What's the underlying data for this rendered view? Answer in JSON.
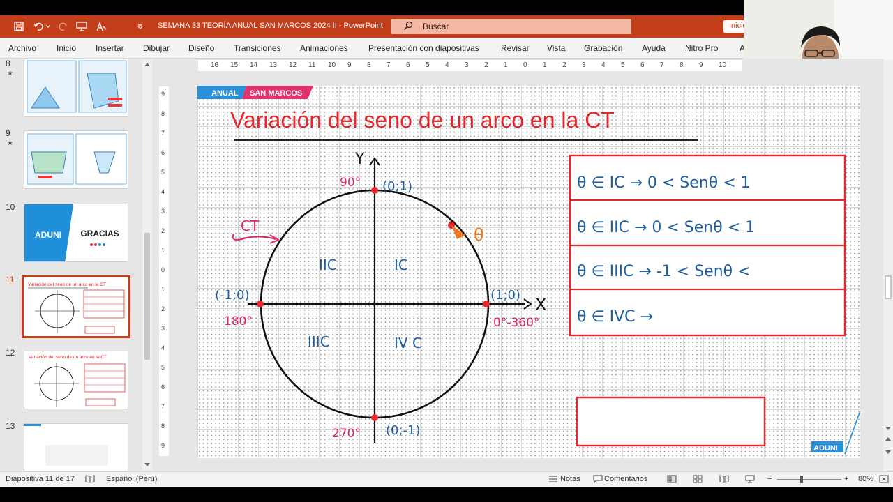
{
  "window": {
    "title": "SEMANA 33 TEORÍA ANUAL SAN MARCOS 2024 II  -  PowerPoint",
    "search_placeholder": "Buscar",
    "start_button": "Inicio",
    "accent": "#c43e1c"
  },
  "ribbon": {
    "tabs": [
      "Archivo",
      "Inicio",
      "Insertar",
      "Dibujar",
      "Diseño",
      "Transiciones",
      "Animaciones",
      "Presentación con diapositivas",
      "Revisar",
      "Vista",
      "Grabación",
      "Ayuda",
      "Nitro Pro",
      "A"
    ]
  },
  "thumbnails": [
    {
      "number": "8",
      "star": "★",
      "title": "",
      "selected": false
    },
    {
      "number": "9",
      "star": "★",
      "title": "",
      "selected": false
    },
    {
      "number": "10",
      "star": "",
      "title": "GRACIAS",
      "brand": "ADUNI",
      "selected": false
    },
    {
      "number": "11",
      "star": "",
      "title": "Variación del seno de un arco en la CT",
      "selected": true
    },
    {
      "number": "12",
      "star": "",
      "title": "Variación del seno de un arco en la CT",
      "selected": false
    },
    {
      "number": "13",
      "star": "",
      "title": "",
      "selected": false
    }
  ],
  "ruler": {
    "h_ticks": [
      "16",
      "15",
      "14",
      "13",
      "12",
      "11",
      "10",
      "9",
      "8",
      "7",
      "6",
      "5",
      "4",
      "3",
      "2",
      "1",
      "0",
      "1",
      "2",
      "3",
      "4",
      "5",
      "6",
      "7",
      "8",
      "9",
      "10"
    ],
    "v_ticks": [
      "9",
      "8",
      "7",
      "6",
      "5",
      "4",
      "3",
      "2",
      "1",
      "0",
      "1",
      "2",
      "3",
      "4",
      "5",
      "6",
      "7",
      "8",
      "9"
    ]
  },
  "slide": {
    "badge_left": "ANUAL",
    "badge_right": "SAN MARCOS",
    "badge_left_color": "#2a8fd8",
    "badge_right_color": "#e0336c",
    "title": "Variación del seno de un arco en la CT",
    "title_color": "#e8262b",
    "axis_x_label": "X",
    "axis_y_label": "Y",
    "ct_label": "CT",
    "point_top": "(0;1)",
    "point_bottom": "(0;-1)",
    "point_left": "(-1;0)",
    "point_right": "(1;0)",
    "angle_top": "90°",
    "angle_bottom": "270°",
    "angle_left": "180°",
    "angle_right": "0°-360°",
    "theta_label": "θ",
    "q1": "IC",
    "q2": "IIC",
    "q3": "IIIC",
    "q4": "IV C",
    "table_rows": [
      "θ ∈ IC → 0 < Senθ < 1",
      "θ ∈ IIC → 0 < Senθ < 1",
      "θ ∈ IIIC → -1 < Senθ <",
      "θ ∈ IVC →"
    ],
    "footer_brand": "ADUNI",
    "ink_blue": "#1f5f9e",
    "ink_pink": "#e0245e",
    "ink_orange": "#f07a20"
  },
  "status": {
    "slide_info": "Diapositiva 11 de 17",
    "language": "Español (Perú)",
    "notes": "Notas",
    "comments": "Comentarios",
    "zoom": "80%",
    "zoom_minus": "−",
    "zoom_plus": "+"
  }
}
